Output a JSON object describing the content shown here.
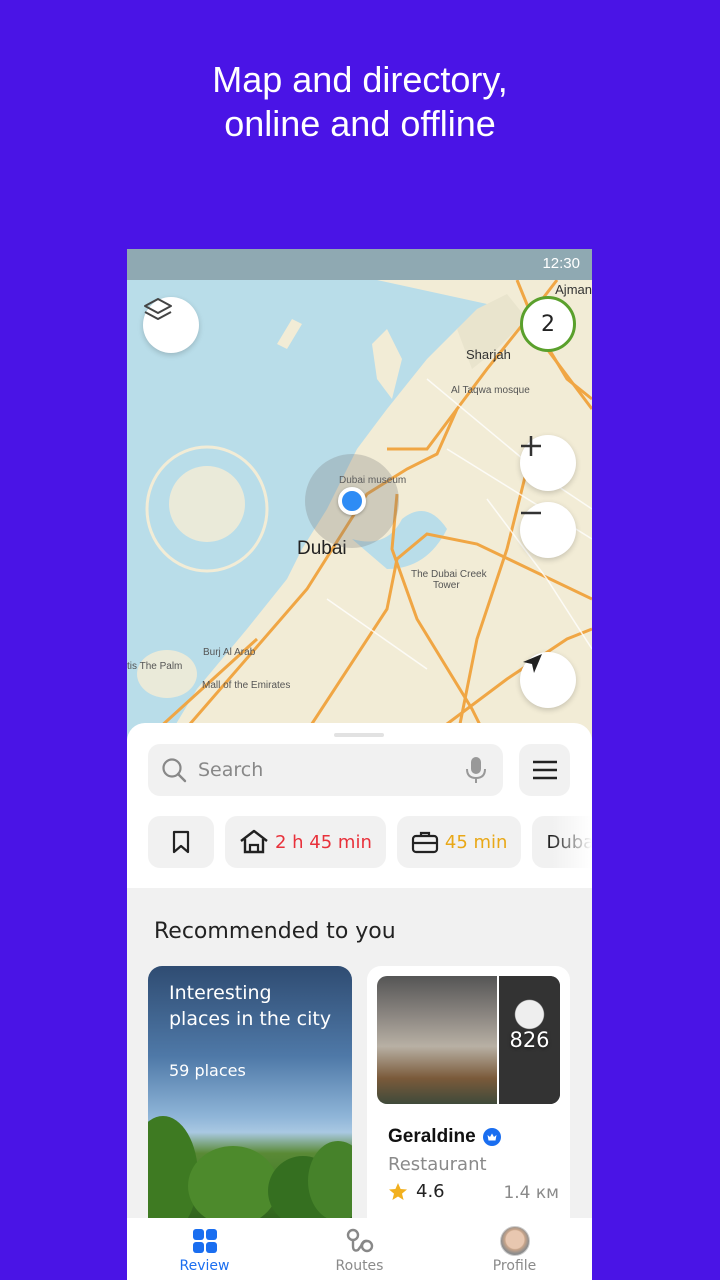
{
  "promo": {
    "headline_line1": "Map and directory,",
    "headline_line2": "online and offline"
  },
  "status_bar": {
    "time": "12:30"
  },
  "map": {
    "cluster_badge": "2",
    "labels": {
      "ajman": "Ajman",
      "sharjah": "Sharjah",
      "al_taqwa": "Al Taqwa mosque",
      "dubai_museum": "Dubai museum",
      "dubai": "Dubai",
      "creek_tower_1": "The Dubai Creek",
      "creek_tower_2": "Tower",
      "burj_al_arab": "Burj Al Arab",
      "atlantis": "tis The Palm",
      "mall": "Mall of the Emirates"
    },
    "colors": {
      "water": "#b9dde9",
      "land": "#f2ecd6",
      "road": "#f0a644"
    }
  },
  "sheet": {
    "search_placeholder": "Search",
    "chips": [
      {
        "icon": "bookmark-icon",
        "label": ""
      },
      {
        "icon": "home-icon",
        "label": "2 h 45 min",
        "color": "#e8313b"
      },
      {
        "icon": "briefcase-icon",
        "label": "45 min",
        "color": "#e9a817"
      },
      {
        "icon": "",
        "label": "Duba"
      }
    ]
  },
  "recommended": {
    "title": "Recommended to you",
    "collection": {
      "title": "Interesting places in the city",
      "subtitle": "59 places"
    },
    "place": {
      "photo_count": "826",
      "name": "Geraldine",
      "category": "Restaurant",
      "rating": "4.6",
      "distance": "1.4 км"
    }
  },
  "tabbar": {
    "tabs": [
      {
        "label": "Review",
        "active": true
      },
      {
        "label": "Routes",
        "active": false
      },
      {
        "label": "Profile",
        "active": false
      }
    ],
    "accent": "#1a6ef0"
  }
}
